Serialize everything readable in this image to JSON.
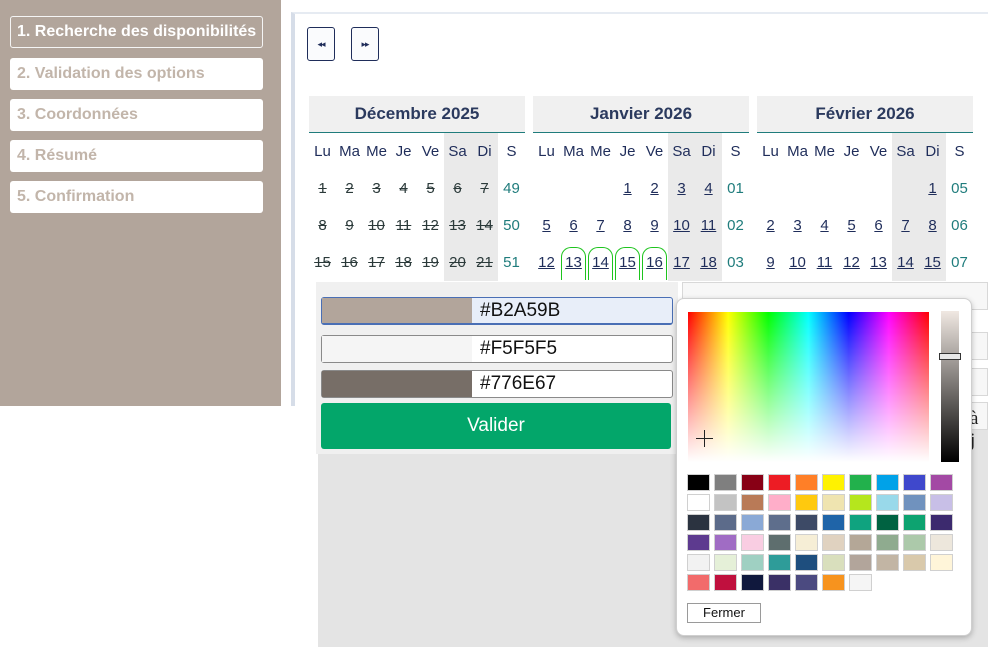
{
  "steps": [
    {
      "label": "1. Recherche des disponibilités",
      "active": true
    },
    {
      "label": "2. Validation des options",
      "active": false
    },
    {
      "label": "3. Coordonnées",
      "active": false
    },
    {
      "label": "4. Résumé",
      "active": false
    },
    {
      "label": "5. Confirmation",
      "active": false
    }
  ],
  "nav": {
    "prev_icon": "double-arrow-left-icon",
    "next_icon": "double-arrow-right-icon"
  },
  "weekday_headers": [
    "Lu",
    "Ma",
    "Me",
    "Je",
    "Ve",
    "Sa",
    "Di",
    "S"
  ],
  "calendar": [
    {
      "title": "Décembre 2025",
      "weeks": [
        {
          "week": "49",
          "days": [
            "1",
            "2",
            "3",
            "4",
            "5",
            "6",
            "7"
          ]
        },
        {
          "week": "50",
          "days": [
            "8",
            "9",
            "10",
            "11",
            "12",
            "13",
            "14"
          ]
        },
        {
          "week": "51",
          "days": [
            "15",
            "16",
            "17",
            "18",
            "19",
            "20",
            "21"
          ]
        }
      ],
      "past_all": true
    },
    {
      "title": "Janvier 2026",
      "weeks": [
        {
          "week": "01",
          "days": [
            "",
            "",
            "",
            "1",
            "2",
            "3",
            "4"
          ]
        },
        {
          "week": "02",
          "days": [
            "5",
            "6",
            "7",
            "8",
            "9",
            "10",
            "11"
          ]
        },
        {
          "week": "03",
          "days": [
            "12",
            "13",
            "14",
            "15",
            "16",
            "17",
            "18"
          ]
        }
      ],
      "selected_days": [
        "13",
        "14",
        "15",
        "16"
      ]
    },
    {
      "title": "Février 2026",
      "weeks": [
        {
          "week": "05",
          "days": [
            "",
            "",
            "",
            "",
            "",
            "",
            "1"
          ]
        },
        {
          "week": "06",
          "days": [
            "2",
            "3",
            "4",
            "5",
            "6",
            "7",
            "8"
          ]
        },
        {
          "week": "07",
          "days": [
            "9",
            "10",
            "11",
            "12",
            "13",
            "14",
            "15"
          ]
        }
      ]
    }
  ],
  "color_rows": [
    {
      "hex": "#B2A59B",
      "swatch": "#B2A59B",
      "focused": true
    },
    {
      "hex": "#F5F5F5",
      "swatch": "#F5F5F5",
      "focused": false
    },
    {
      "hex": "#776E67",
      "swatch": "#776E67",
      "focused": false
    }
  ],
  "valider_label": "Valider",
  "fermer_label": "Fermer",
  "ghost_text": "à j",
  "palette": [
    "#000000",
    "#7f7f7f",
    "#880015",
    "#ed1c24",
    "#ff7f27",
    "#fff200",
    "#22b14c",
    "#00a2e8",
    "#3f48cc",
    "#a349a4",
    "#ffffff",
    "#c3c3c3",
    "#b97a57",
    "#ffaec9",
    "#ffc90e",
    "#efe4b0",
    "#b5e61d",
    "#99d9ea",
    "#7092be",
    "#c8bfe7",
    "#2b3340",
    "#5c6b8a",
    "#8aa9d6",
    "#5e6e8c",
    "#3d4a66",
    "#1f64a8",
    "#0fa37f",
    "#006241",
    "#0da370",
    "#3c2a6e",
    "#5d3a8f",
    "#a06cc4",
    "#f9cde2",
    "#5e6e6e",
    "#f6eed6",
    "#e0d2c0",
    "#b4a797",
    "#8fab8f",
    "#acc9aa",
    "#ede7dc",
    "#f2f2f2",
    "#e5f0d8",
    "#9fd0c2",
    "#2e9c99",
    "#1e4e7e",
    "#d9dfbd",
    "#b2a59b",
    "#c2b5a4",
    "#d9c9ab",
    "#fff5d9",
    "#f26b6b",
    "#c0103e",
    "#10183d",
    "#3a3066",
    "#4b4a80",
    "#f7931e",
    "#f5f5f5"
  ]
}
